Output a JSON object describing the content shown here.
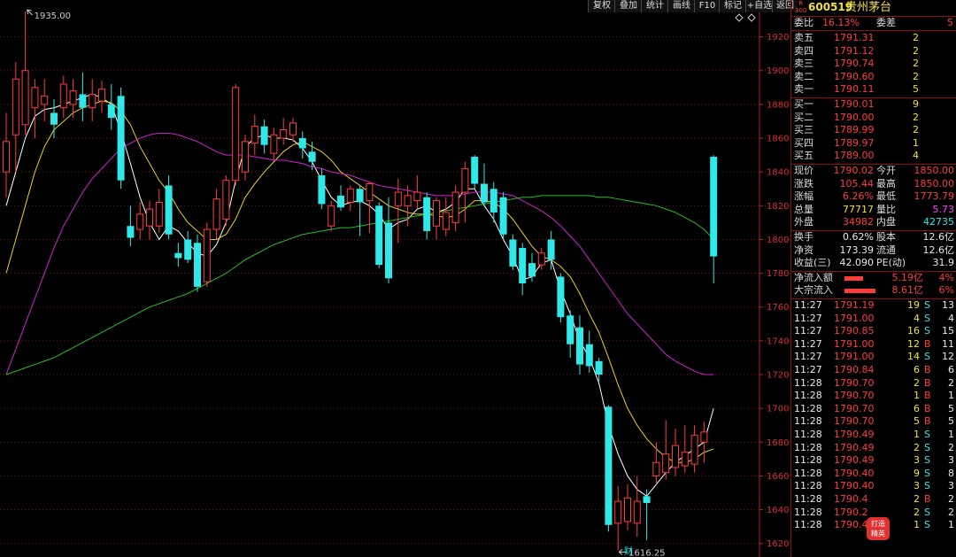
{
  "toolbar": {
    "buttons": [
      "复权",
      "叠加",
      "统计",
      "画线",
      "F10",
      "标记",
      "+自选",
      "返回"
    ]
  },
  "stock": {
    "badge_top": "R",
    "badge_bottom": "300",
    "code": "600519",
    "name": "贵州茅台"
  },
  "weibi": {
    "label": "委比",
    "value": "16.13%",
    "label2": "委差",
    "value2": "5"
  },
  "asks": [
    {
      "label": "卖五",
      "price": "1791.31",
      "vol": "2"
    },
    {
      "label": "卖四",
      "price": "1791.12",
      "vol": "2"
    },
    {
      "label": "卖三",
      "price": "1790.74",
      "vol": "2"
    },
    {
      "label": "卖二",
      "price": "1790.60",
      "vol": "2"
    },
    {
      "label": "卖一",
      "price": "1790.11",
      "vol": "5"
    }
  ],
  "bids": [
    {
      "label": "买一",
      "price": "1790.01",
      "vol": "9"
    },
    {
      "label": "买二",
      "price": "1790.00",
      "vol": "2"
    },
    {
      "label": "买三",
      "price": "1789.99",
      "vol": "2"
    },
    {
      "label": "买四",
      "price": "1789.97",
      "vol": "1"
    },
    {
      "label": "买五",
      "price": "1789.00",
      "vol": "4"
    }
  ],
  "stats": [
    {
      "l1": "现价",
      "v1": "1790.02",
      "c1": "red",
      "l2": "今开",
      "v2": "1850.00",
      "c2": "red"
    },
    {
      "l1": "涨跌",
      "v1": "105.44",
      "c1": "red",
      "l2": "最高",
      "v2": "1850.00",
      "c2": "red"
    },
    {
      "l1": "涨幅",
      "v1": "6.26%",
      "c1": "red",
      "l2": "最低",
      "v2": "1773.79",
      "c2": "red"
    },
    {
      "l1": "总量",
      "v1": "77717",
      "c1": "yellow",
      "l2": "量比",
      "v2": "5.73",
      "c2": "magenta"
    },
    {
      "l1": "外盘",
      "v1": "34982",
      "c1": "red",
      "l2": "内盘",
      "v2": "42735",
      "c2": "cyan"
    }
  ],
  "stats2": [
    {
      "l1": "换手",
      "v1": "0.62%",
      "l2": "股本",
      "v2": "12.6亿"
    },
    {
      "l1": "净资",
      "v1": "173.39",
      "l2": "流通",
      "v2": "12.6亿"
    },
    {
      "l1": "收益(三)",
      "v1": "42.090",
      "l2": "PE(动)",
      "v2": "31.9"
    }
  ],
  "flows": [
    {
      "label": "净流入额",
      "value": "5.19亿",
      "pct": "4%",
      "bar_fraction": 0.45
    },
    {
      "label": "大宗流入",
      "value": "8.61亿",
      "pct": "6%",
      "bar_fraction": 0.75
    }
  ],
  "trades": [
    {
      "time": "11:27",
      "price": "1791.19",
      "vol": "19",
      "side": "S",
      "n": "13"
    },
    {
      "time": "11:27",
      "price": "1791.00",
      "vol": "4",
      "side": "S",
      "n": "4"
    },
    {
      "time": "11:27",
      "price": "1790.85",
      "vol": "16",
      "side": "S",
      "n": "15"
    },
    {
      "time": "11:27",
      "price": "1791.00",
      "vol": "12",
      "side": "B",
      "n": "11"
    },
    {
      "time": "11:27",
      "price": "1791.00",
      "vol": "14",
      "side": "S",
      "n": "12"
    },
    {
      "time": "11:27",
      "price": "1790.84",
      "vol": "6",
      "side": "B",
      "n": "6"
    },
    {
      "time": "11:28",
      "price": "1790.70",
      "vol": "2",
      "side": "B",
      "n": "2"
    },
    {
      "time": "11:28",
      "price": "1790.70",
      "vol": "1",
      "side": "B",
      "n": "1"
    },
    {
      "time": "11:28",
      "price": "1790.70",
      "vol": "6",
      "side": "B",
      "n": "5"
    },
    {
      "time": "11:28",
      "price": "1790.70",
      "vol": "5",
      "side": "B",
      "n": "5"
    },
    {
      "time": "11:28",
      "price": "1790.49",
      "vol": "1",
      "side": "S",
      "n": "1"
    },
    {
      "time": "11:28",
      "price": "1790.49",
      "vol": "2",
      "side": "S",
      "n": "2"
    },
    {
      "time": "11:28",
      "price": "1790.49",
      "vol": "3",
      "side": "S",
      "n": "3"
    },
    {
      "time": "11:28",
      "price": "1790.40",
      "vol": "9",
      "side": "S",
      "n": "8"
    },
    {
      "time": "11:28",
      "price": "1790.40",
      "vol": "3",
      "side": "S",
      "n": "3"
    },
    {
      "time": "11:28",
      "price": "1790.4",
      "vol": "2",
      "side": "B",
      "n": "2"
    },
    {
      "time": "11:28",
      "price": "1790.2",
      "vol": "2",
      "side": "S",
      "n": "2"
    },
    {
      "time": "11:28",
      "price": "1790.40",
      "vol": "1",
      "side": "S",
      "n": "1"
    }
  ],
  "badge": {
    "line1": "打造",
    "line2": "精英"
  },
  "colors": {
    "up": "#ff3c3c",
    "down": "#30e8e8",
    "ma5": "#ffffff",
    "ma10": "#e8d020",
    "ma20": "#d020d0",
    "ma60": "#20c020",
    "grid": "#7a1010"
  },
  "chart_data": {
    "type": "candlestick",
    "yaxis_ticks": [
      1920,
      1900,
      1880,
      1860,
      1840,
      1820,
      1800,
      1780,
      1760,
      1740,
      1720,
      1700,
      1680,
      1660,
      1640,
      1620
    ],
    "ylim": [
      1612,
      1935
    ],
    "high_annotation": "1935.00",
    "low_annotation": "1616.25",
    "event_marker": "财",
    "candles": [
      {
        "o": 1840,
        "c": 1858,
        "h": 1875,
        "l": 1825
      },
      {
        "o": 1862,
        "c": 1895,
        "h": 1905,
        "l": 1840
      },
      {
        "o": 1868,
        "c": 1900,
        "h": 1935,
        "l": 1862
      },
      {
        "o": 1878,
        "c": 1890,
        "h": 1895,
        "l": 1860
      },
      {
        "o": 1880,
        "c": 1885,
        "h": 1895,
        "l": 1870
      },
      {
        "o": 1875,
        "c": 1868,
        "h": 1883,
        "l": 1860
      },
      {
        "o": 1878,
        "c": 1892,
        "h": 1897,
        "l": 1872
      },
      {
        "o": 1880,
        "c": 1888,
        "h": 1895,
        "l": 1872
      },
      {
        "o": 1886,
        "c": 1878,
        "h": 1899,
        "l": 1870
      },
      {
        "o": 1878,
        "c": 1886,
        "h": 1895,
        "l": 1870
      },
      {
        "o": 1882,
        "c": 1889,
        "h": 1894,
        "l": 1875
      },
      {
        "o": 1880,
        "c": 1872,
        "h": 1892,
        "l": 1865
      },
      {
        "o": 1885,
        "c": 1835,
        "h": 1890,
        "l": 1830
      },
      {
        "o": 1808,
        "c": 1801,
        "h": 1820,
        "l": 1796
      },
      {
        "o": 1806,
        "c": 1815,
        "h": 1822,
        "l": 1800
      },
      {
        "o": 1808,
        "c": 1818,
        "h": 1823,
        "l": 1800
      },
      {
        "o": 1808,
        "c": 1822,
        "h": 1830,
        "l": 1804
      },
      {
        "o": 1832,
        "c": 1803,
        "h": 1838,
        "l": 1800
      },
      {
        "o": 1792,
        "c": 1789,
        "h": 1798,
        "l": 1784
      },
      {
        "o": 1800,
        "c": 1788,
        "h": 1805,
        "l": 1786
      },
      {
        "o": 1798,
        "c": 1772,
        "h": 1803,
        "l": 1769
      },
      {
        "o": 1775,
        "c": 1806,
        "h": 1810,
        "l": 1772
      },
      {
        "o": 1806,
        "c": 1824,
        "h": 1830,
        "l": 1800
      },
      {
        "o": 1812,
        "c": 1835,
        "h": 1838,
        "l": 1808
      },
      {
        "o": 1835,
        "c": 1890,
        "h": 1892,
        "l": 1832
      },
      {
        "o": 1840,
        "c": 1858,
        "h": 1862,
        "l": 1835
      },
      {
        "o": 1857,
        "c": 1867,
        "h": 1874,
        "l": 1850
      },
      {
        "o": 1867,
        "c": 1856,
        "h": 1871,
        "l": 1851
      },
      {
        "o": 1851,
        "c": 1862,
        "h": 1866,
        "l": 1847
      },
      {
        "o": 1860,
        "c": 1865,
        "h": 1872,
        "l": 1856
      },
      {
        "o": 1862,
        "c": 1869,
        "h": 1872,
        "l": 1858
      },
      {
        "o": 1860,
        "c": 1854,
        "h": 1864,
        "l": 1848
      },
      {
        "o": 1852,
        "c": 1846,
        "h": 1858,
        "l": 1841
      },
      {
        "o": 1838,
        "c": 1821,
        "h": 1842,
        "l": 1818
      },
      {
        "o": 1808,
        "c": 1820,
        "h": 1823,
        "l": 1805
      },
      {
        "o": 1826,
        "c": 1819,
        "h": 1832,
        "l": 1817
      },
      {
        "o": 1822,
        "c": 1830,
        "h": 1832,
        "l": 1817
      },
      {
        "o": 1830,
        "c": 1822,
        "h": 1832,
        "l": 1802
      },
      {
        "o": 1823,
        "c": 1833,
        "h": 1834,
        "l": 1804
      },
      {
        "o": 1820,
        "c": 1785,
        "h": 1822,
        "l": 1783
      },
      {
        "o": 1810,
        "c": 1777,
        "h": 1825,
        "l": 1774
      },
      {
        "o": 1820,
        "c": 1828,
        "h": 1836,
        "l": 1798
      },
      {
        "o": 1820,
        "c": 1826,
        "h": 1832,
        "l": 1808
      },
      {
        "o": 1823,
        "c": 1828,
        "h": 1838,
        "l": 1818
      },
      {
        "o": 1825,
        "c": 1805,
        "h": 1828,
        "l": 1800
      },
      {
        "o": 1808,
        "c": 1823,
        "h": 1825,
        "l": 1800
      },
      {
        "o": 1806,
        "c": 1816,
        "h": 1825,
        "l": 1802
      },
      {
        "o": 1810,
        "c": 1828,
        "h": 1832,
        "l": 1805
      },
      {
        "o": 1828,
        "c": 1842,
        "h": 1846,
        "l": 1810
      },
      {
        "o": 1849,
        "c": 1833,
        "h": 1850,
        "l": 1830
      },
      {
        "o": 1833,
        "c": 1822,
        "h": 1845,
        "l": 1820
      },
      {
        "o": 1830,
        "c": 1816,
        "h": 1834,
        "l": 1810
      },
      {
        "o": 1825,
        "c": 1803,
        "h": 1828,
        "l": 1800
      },
      {
        "o": 1800,
        "c": 1784,
        "h": 1803,
        "l": 1782
      },
      {
        "o": 1795,
        "c": 1774,
        "h": 1798,
        "l": 1767
      },
      {
        "o": 1786,
        "c": 1778,
        "h": 1792,
        "l": 1775
      },
      {
        "o": 1785,
        "c": 1792,
        "h": 1795,
        "l": 1782
      },
      {
        "o": 1800,
        "c": 1788,
        "h": 1805,
        "l": 1782
      },
      {
        "o": 1778,
        "c": 1754,
        "h": 1780,
        "l": 1751
      },
      {
        "o": 1755,
        "c": 1738,
        "h": 1758,
        "l": 1730
      },
      {
        "o": 1748,
        "c": 1726,
        "h": 1755,
        "l": 1720
      },
      {
        "o": 1738,
        "c": 1725,
        "h": 1746,
        "l": 1721
      },
      {
        "o": 1728,
        "c": 1720,
        "h": 1730,
        "l": 1716
      },
      {
        "o": 1701,
        "c": 1631,
        "h": 1702,
        "l": 1627
      },
      {
        "o": 1632,
        "c": 1645,
        "h": 1654,
        "l": 1616
      },
      {
        "o": 1633,
        "c": 1647,
        "h": 1655,
        "l": 1628
      },
      {
        "o": 1632,
        "c": 1645,
        "h": 1660,
        "l": 1624
      },
      {
        "o": 1648,
        "c": 1644,
        "h": 1652,
        "l": 1622
      },
      {
        "o": 1660,
        "c": 1668,
        "h": 1680,
        "l": 1655
      },
      {
        "o": 1662,
        "c": 1673,
        "h": 1693,
        "l": 1658
      },
      {
        "o": 1665,
        "c": 1678,
        "h": 1688,
        "l": 1660
      },
      {
        "o": 1666,
        "c": 1674,
        "h": 1690,
        "l": 1662
      },
      {
        "o": 1667,
        "c": 1684,
        "h": 1690,
        "l": 1662
      },
      {
        "o": 1680,
        "c": 1686,
        "h": 1692,
        "l": 1668
      },
      {
        "o": 1849,
        "c": 1790,
        "h": 1850,
        "l": 1774
      }
    ],
    "ma_series": [
      {
        "name": "ma5",
        "values": [
          1820,
          1840,
          1860,
          1873,
          1877,
          1878,
          1880,
          1882,
          1884,
          1886,
          1884,
          1880,
          1864,
          1845,
          1825,
          1810,
          1800,
          1808,
          1805,
          1798,
          1792,
          1790,
          1797,
          1810,
          1835,
          1855,
          1860,
          1862,
          1860,
          1860,
          1859,
          1854,
          1846,
          1835,
          1825,
          1820,
          1822,
          1823,
          1820,
          1815,
          1806,
          1810,
          1812,
          1818,
          1820,
          1816,
          1818,
          1822,
          1830,
          1830,
          1820,
          1812,
          1800,
          1790,
          1776,
          1778,
          1786,
          1788,
          1770,
          1756,
          1740,
          1730,
          1715,
          1690,
          1673,
          1660,
          1652,
          1648,
          1655,
          1662,
          1668,
          1672,
          1676,
          1680,
          1700
        ]
      },
      {
        "name": "ma10",
        "values": [
          1780,
          1800,
          1820,
          1840,
          1855,
          1865,
          1870,
          1875,
          1878,
          1880,
          1882,
          1881,
          1876,
          1868,
          1855,
          1845,
          1835,
          1828,
          1818,
          1810,
          1805,
          1800,
          1800,
          1803,
          1812,
          1825,
          1833,
          1840,
          1846,
          1852,
          1856,
          1858,
          1855,
          1852,
          1847,
          1840,
          1836,
          1832,
          1828,
          1824,
          1820,
          1818,
          1816,
          1815,
          1815,
          1814,
          1813,
          1814,
          1818,
          1823,
          1823,
          1822,
          1818,
          1812,
          1804,
          1796,
          1790,
          1788,
          1784,
          1778,
          1768,
          1756,
          1745,
          1730,
          1714,
          1700,
          1690,
          1682,
          1676,
          1671,
          1668,
          1668,
          1670,
          1674,
          1676
        ]
      },
      {
        "name": "ma20",
        "values": [
          1720,
          1735,
          1750,
          1765,
          1780,
          1795,
          1808,
          1818,
          1828,
          1836,
          1842,
          1848,
          1854,
          1857,
          1860,
          1862,
          1863,
          1863,
          1862,
          1860,
          1858,
          1855,
          1852,
          1850,
          1850,
          1850,
          1849,
          1848,
          1847,
          1847,
          1846,
          1845,
          1843,
          1842,
          1840,
          1839,
          1838,
          1836,
          1834,
          1832,
          1831,
          1830,
          1829,
          1828,
          1827,
          1826,
          1826,
          1826,
          1827,
          1828,
          1828,
          1828,
          1827,
          1826,
          1823,
          1820,
          1817,
          1813,
          1808,
          1802,
          1796,
          1788,
          1780,
          1772,
          1764,
          1756,
          1750,
          1744,
          1738,
          1732,
          1728,
          1725,
          1722,
          1720,
          1720
        ]
      },
      {
        "name": "ma60",
        "values": [
          1720,
          1722,
          1724,
          1726,
          1728,
          1730,
          1733,
          1736,
          1739,
          1742,
          1745,
          1748,
          1751,
          1754,
          1757,
          1760,
          1762,
          1764,
          1766,
          1768,
          1771,
          1774,
          1777,
          1780,
          1784,
          1788,
          1791,
          1794,
          1797,
          1799,
          1801,
          1803,
          1804,
          1805,
          1806,
          1807,
          1807,
          1808,
          1809,
          1810,
          1811,
          1812,
          1813,
          1814,
          1815,
          1816,
          1817,
          1818,
          1819,
          1820,
          1821,
          1822,
          1823,
          1824,
          1825,
          1825,
          1826,
          1826,
          1826,
          1826,
          1826,
          1826,
          1825,
          1825,
          1824,
          1823,
          1822,
          1821,
          1820,
          1818,
          1816,
          1813,
          1810,
          1806,
          1800
        ]
      }
    ]
  }
}
